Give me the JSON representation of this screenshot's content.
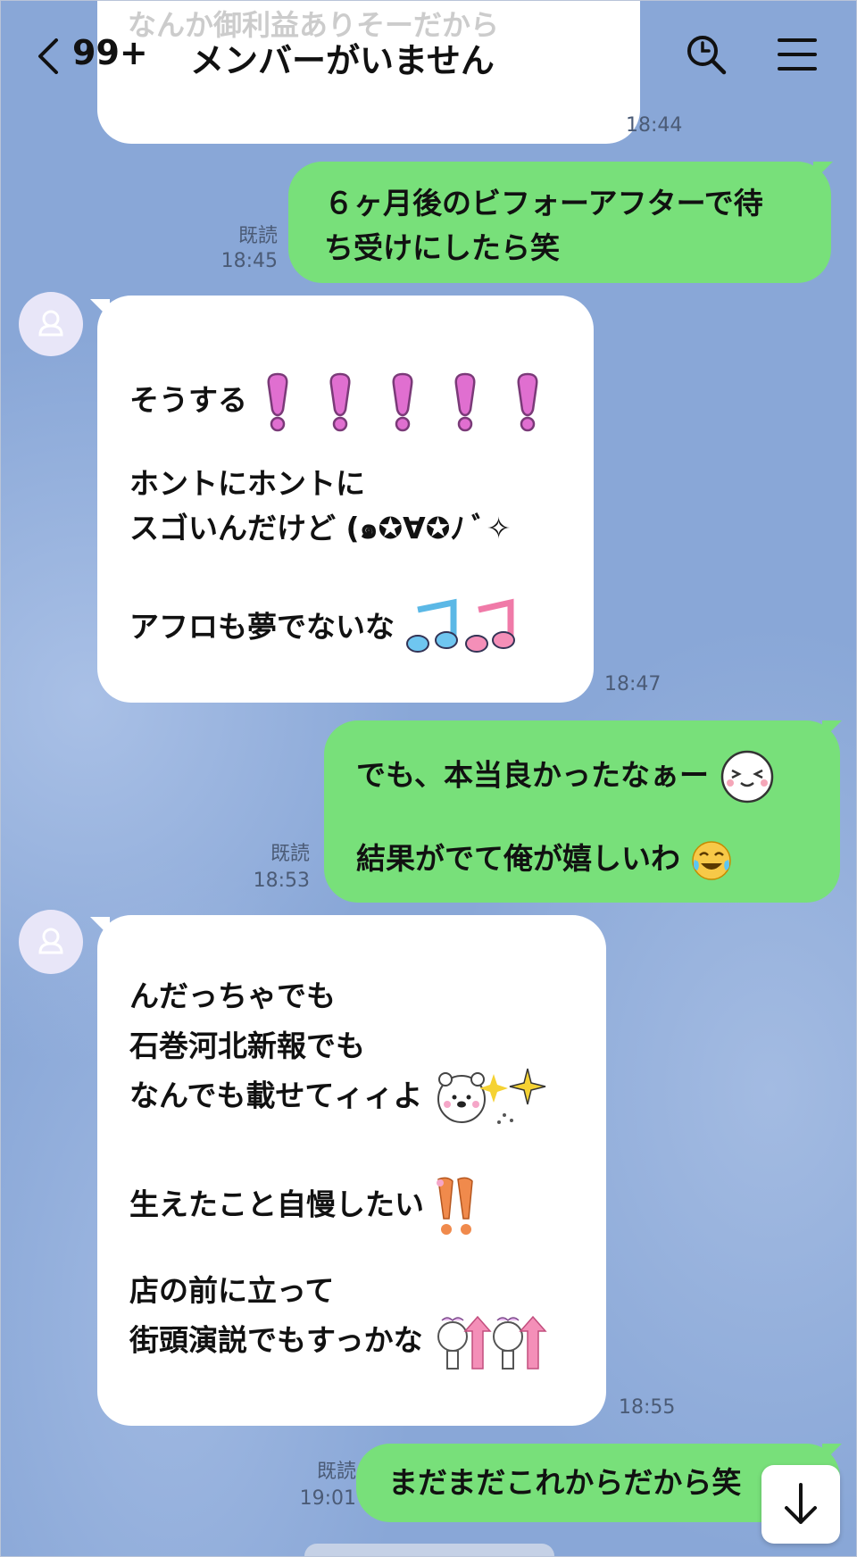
{
  "header": {
    "unread_count": "99+",
    "title": "メンバーがいません"
  },
  "messages": [
    {
      "side": "left",
      "partial_text": "なんか御利益ありそーだから",
      "time": "18:44"
    },
    {
      "side": "right",
      "lines": [
        "６ヶ月後のビフォーアフターで待",
        "ち受けにしたら笑"
      ],
      "read": "既読",
      "time": "18:45"
    },
    {
      "side": "left",
      "lines": [
        "そうする",
        "ホントにホントに",
        "スゴいんだけど (๑✪∀✪ﾉ ﾞ✧",
        "アフロも夢でないな"
      ],
      "time": "18:47"
    },
    {
      "side": "right",
      "lines": [
        "でも、本当良かったなぁー",
        "結果がでて俺が嬉しいわ"
      ],
      "read": "既読",
      "time": "18:53"
    },
    {
      "side": "left",
      "lines": [
        "んだっちゃでも",
        "石巻河北新報でも",
        "なんでも載せてィィよ",
        "生えたこと自慢したい",
        "店の前に立って",
        "街頭演説でもすっかな"
      ],
      "time": "18:55"
    },
    {
      "side": "right",
      "lines": [
        "まだまだこれからだから笑"
      ],
      "read": "既読",
      "time": "19:01"
    }
  ],
  "icons": [
    "back-icon",
    "search-icon",
    "menu-icon",
    "avatar-icon",
    "exclamation-emoji",
    "music-note-emoji",
    "laughing-face-emoji",
    "tears-of-joy-emoji",
    "bear-sparkle-sticker",
    "exclamation-sticker",
    "bear-arrow-sticker",
    "scroll-down-icon"
  ],
  "colors": {
    "background": "#89a7d7",
    "incoming_bubble": "#ffffff",
    "outgoing_bubble": "#78e07a"
  }
}
